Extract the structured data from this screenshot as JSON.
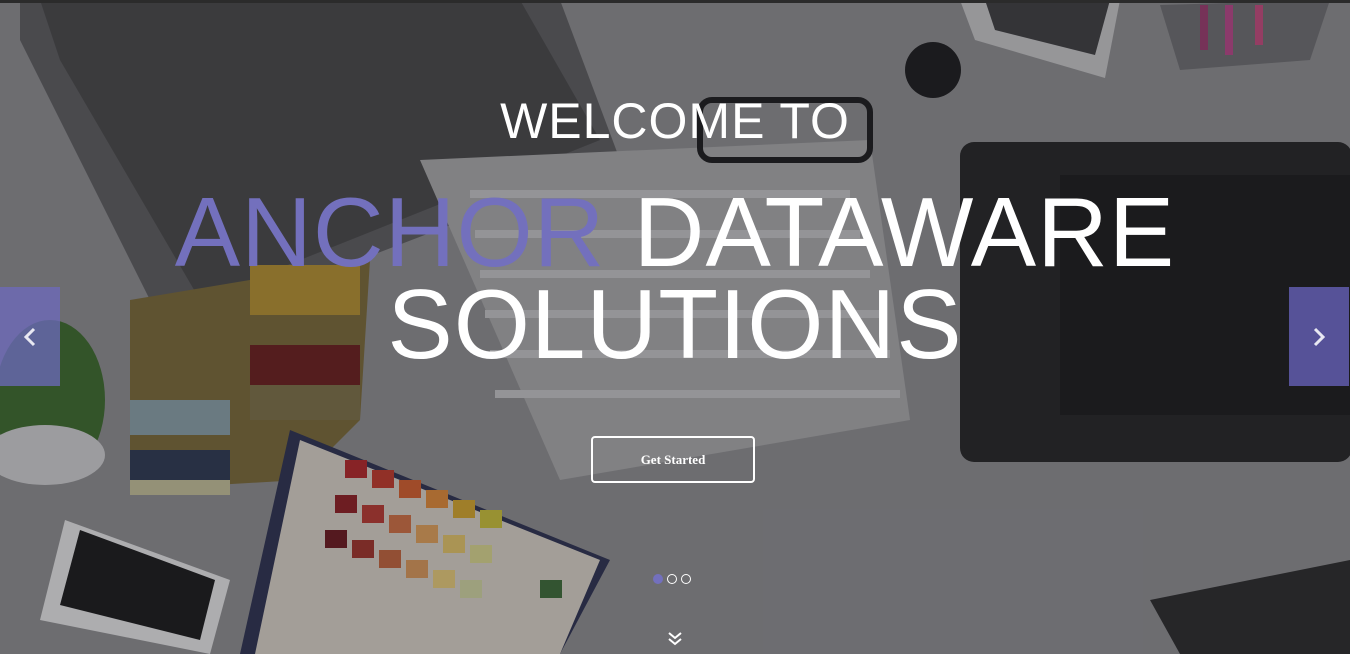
{
  "hero": {
    "welcome": "WELCOME TO",
    "title_accent": "ANCHOR",
    "title_rest": " DATAWARE",
    "title_line2": "SOLUTIONS",
    "cta_label": "Get Started"
  },
  "slider": {
    "slide_count": 3,
    "active_slide": 1,
    "prev_icon": "chevron-left-icon",
    "next_icon": "chevron-right-icon"
  },
  "scroll": {
    "icon": "double-chevron-down-icon"
  },
  "colors": {
    "accent": "#7370bd",
    "text": "#ffffff",
    "arrow_bg": "#6e6abe"
  }
}
